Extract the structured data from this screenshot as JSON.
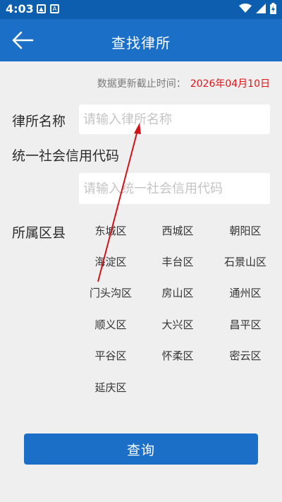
{
  "status_bar": {
    "time": "4:03"
  },
  "header": {
    "title": "查找律所"
  },
  "update": {
    "label": "数据更新截止时间：",
    "date": "2026年04月10日"
  },
  "form": {
    "name_label": "律所名称",
    "name_placeholder": "请输入律所名称",
    "name_value": "",
    "code_label": "统一社会信用代码",
    "code_placeholder": "请输入统一社会信用代码",
    "code_value": "",
    "district_label": "所属区县"
  },
  "districts": [
    "东城区",
    "西城区",
    "朝阳区",
    "海淀区",
    "丰台区",
    "石景山区",
    "门头沟区",
    "房山区",
    "通州区",
    "顺义区",
    "大兴区",
    "昌平区",
    "平谷区",
    "怀柔区",
    "密云区",
    "延庆区"
  ],
  "query_button": "查询",
  "colors": {
    "header": "#1b6fc6",
    "status_bar": "#0d5eaf",
    "date": "#e0161b",
    "arrow": "#d0141a"
  }
}
